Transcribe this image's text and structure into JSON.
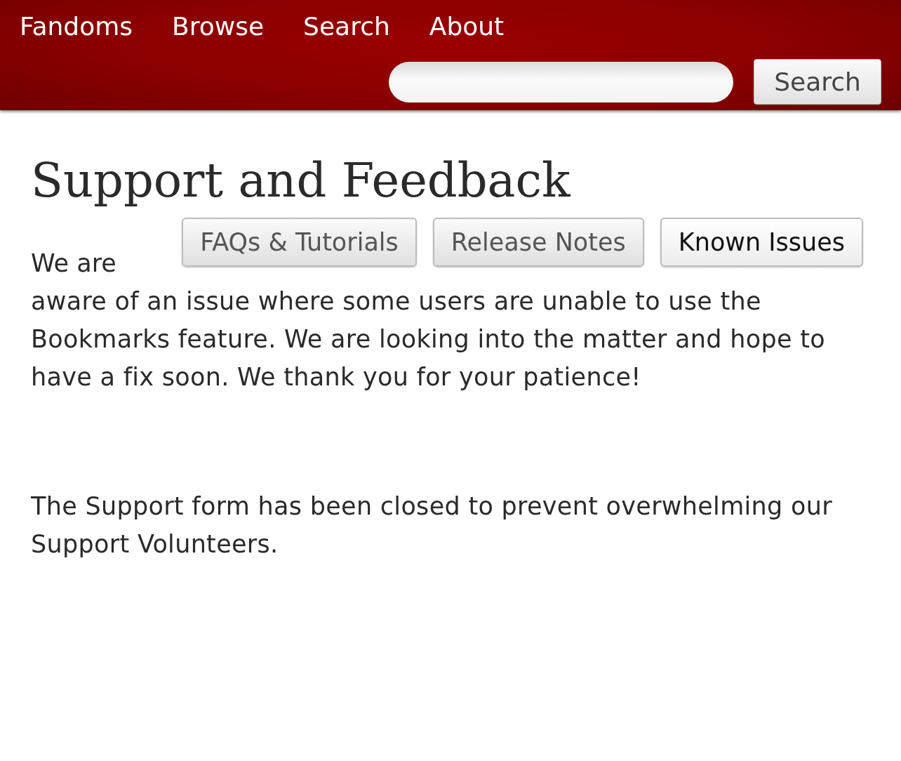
{
  "nav": [
    {
      "label": "Fandoms"
    },
    {
      "label": "Browse"
    },
    {
      "label": "Search"
    },
    {
      "label": "About"
    }
  ],
  "search": {
    "button": "Search"
  },
  "title": "Support and Feedback",
  "buttons": [
    {
      "label": "FAQs & Tutorials",
      "selected": false
    },
    {
      "label": "Release Notes",
      "selected": false
    },
    {
      "label": "Known Issues",
      "selected": true
    }
  ],
  "lead": "We are",
  "paragraphs": [
    "aware of an issue where some users are unable to use the Bookmarks feature. We are looking into the matter and hope to have a fix soon. We thank you for your patience!",
    "The Support form has been closed to prevent overwhelming our Support Volunteers."
  ]
}
